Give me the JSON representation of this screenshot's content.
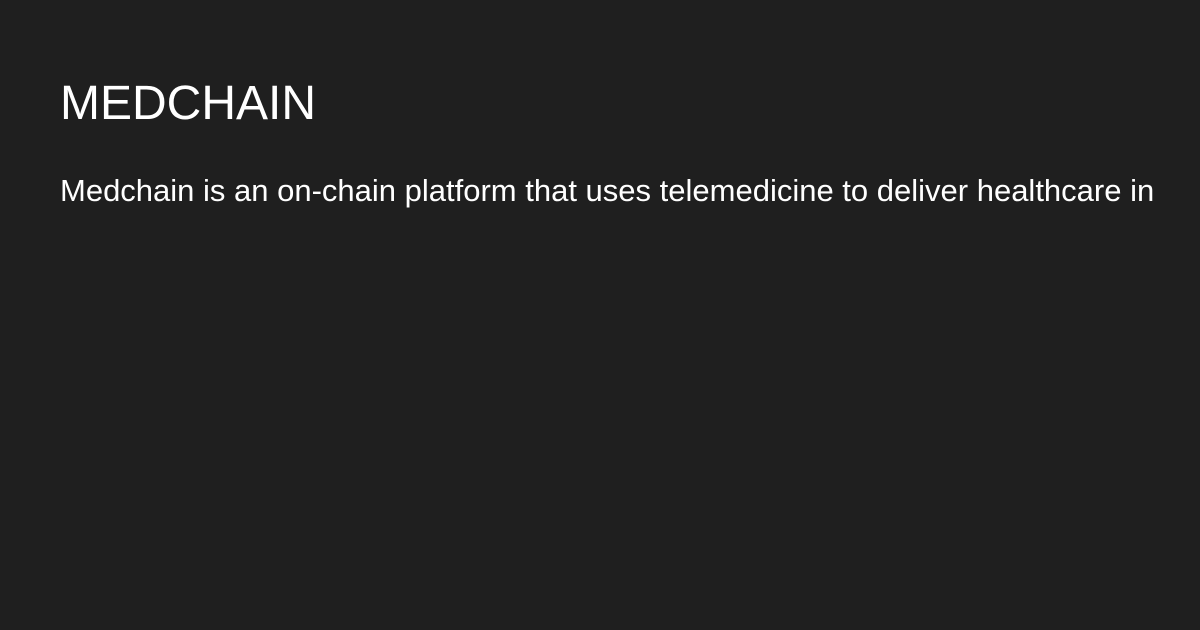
{
  "card": {
    "title": "MEDCHAIN",
    "description": "Medchain is an on-chain platform that uses telemedicine to deliver healthcare in"
  },
  "colors": {
    "background": "#1f1f1f",
    "text": "#ffffff"
  }
}
